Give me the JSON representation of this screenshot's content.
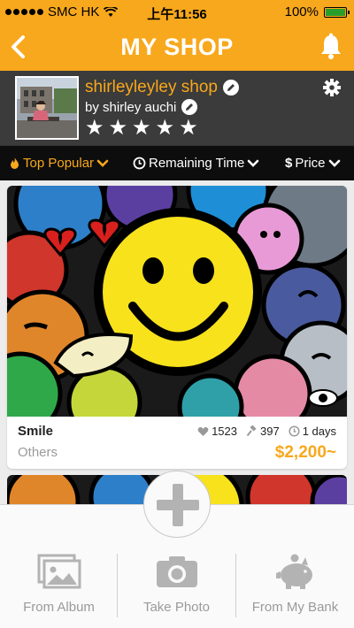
{
  "status_bar": {
    "carrier": "SMC HK",
    "time": "上午11:56",
    "battery": "100%"
  },
  "header": {
    "title": "MY SHOP"
  },
  "profile": {
    "shop_name": "shirleyleyley shop",
    "owner": "by shirley auchi",
    "rating": 5
  },
  "sort": {
    "tabs": [
      {
        "label": "Top Popular",
        "icon": "flame-icon",
        "active": true
      },
      {
        "label": "Remaining Time",
        "icon": "clock-icon",
        "active": false
      },
      {
        "label": "Price",
        "icon": "dollar-icon",
        "active": false
      }
    ]
  },
  "items": [
    {
      "title": "Smile",
      "category": "Others",
      "likes": "1523",
      "bids": "397",
      "time_left": "1 days",
      "price": "$2,200~"
    }
  ],
  "actions": {
    "from_album": "From Album",
    "take_photo": "Take Photo",
    "from_bank": "From My Bank"
  },
  "colors": {
    "accent": "#f8a81c",
    "profile_bg": "#3b3b3b",
    "sort_bg": "#0d0d0d"
  }
}
